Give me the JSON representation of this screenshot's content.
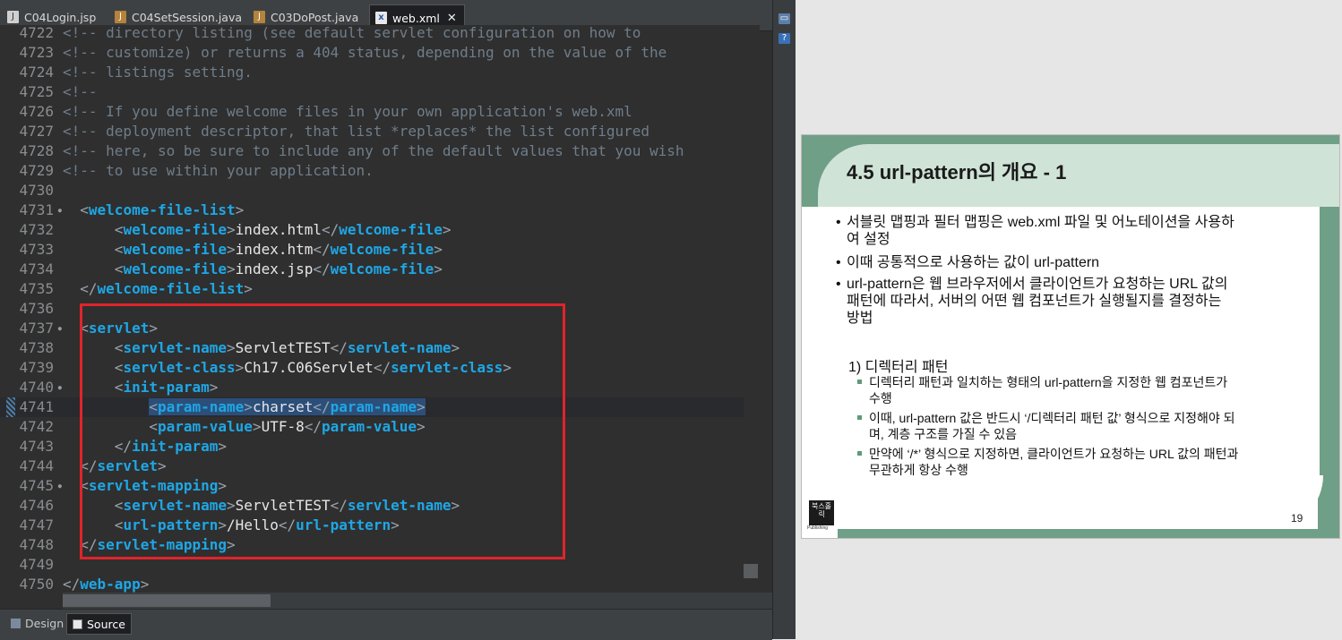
{
  "tabs": [
    {
      "label": "C04Login.jsp",
      "icon": "jsp-file-icon"
    },
    {
      "label": "C04SetSession.java",
      "icon": "java-file-icon"
    },
    {
      "label": "C03DoPost.java",
      "icon": "java-file-icon"
    },
    {
      "label": "web.xml",
      "icon": "xml-file-icon",
      "active": true
    }
  ],
  "code_lines": [
    {
      "n": "4722",
      "text": "<!-- directory listing (see default servlet configuration on how to"
    },
    {
      "n": "4723",
      "text": "<!-- customize) or returns a 404 status, depending on the value of the"
    },
    {
      "n": "4724",
      "text": "<!-- listings setting."
    },
    {
      "n": "4725",
      "text": "<!--"
    },
    {
      "n": "4726",
      "text": "<!-- If you define welcome files in your own application's web.xml"
    },
    {
      "n": "4727",
      "text": "<!-- deployment descriptor, that list *replaces* the list configured"
    },
    {
      "n": "4728",
      "text": "<!-- here, so be sure to include any of the default values that you wish"
    },
    {
      "n": "4729",
      "text": "<!-- to use within your application."
    },
    {
      "n": "4730",
      "text": ""
    },
    {
      "n": "4731",
      "text": "  <welcome-file-list>",
      "fold": true
    },
    {
      "n": "4732",
      "text": "      <welcome-file>index.html</welcome-file>"
    },
    {
      "n": "4733",
      "text": "      <welcome-file>index.htm</welcome-file>"
    },
    {
      "n": "4734",
      "text": "      <welcome-file>index.jsp</welcome-file>"
    },
    {
      "n": "4735",
      "text": "  </welcome-file-list>"
    },
    {
      "n": "4736",
      "text": ""
    },
    {
      "n": "4737",
      "text": "  <servlet>",
      "fold": true
    },
    {
      "n": "4738",
      "text": "      <servlet-name>ServletTEST</servlet-name>"
    },
    {
      "n": "4739",
      "text": "      <servlet-class>Ch17.C06Servlet</servlet-class>"
    },
    {
      "n": "4740",
      "text": "      <init-param>",
      "fold": true
    },
    {
      "n": "4741",
      "text": "          <param-name>charset</param-name>",
      "current": true,
      "selected": true
    },
    {
      "n": "4742",
      "text": "          <param-value>UTF-8</param-value>"
    },
    {
      "n": "4743",
      "text": "      </init-param>"
    },
    {
      "n": "4744",
      "text": "  </servlet>"
    },
    {
      "n": "4745",
      "text": "  <servlet-mapping>",
      "fold": true
    },
    {
      "n": "4746",
      "text": "      <servlet-name>ServletTEST</servlet-name>"
    },
    {
      "n": "4747",
      "text": "      <url-pattern>/Hello</url-pattern>"
    },
    {
      "n": "4748",
      "text": "  </servlet-mapping>"
    },
    {
      "n": "4749",
      "text": ""
    },
    {
      "n": "4750",
      "text": "</web-app>"
    }
  ],
  "bottom_tabs": {
    "design": "Design",
    "source": "Source"
  },
  "slide": {
    "title": "4.5 url-pattern의 개요 - 1",
    "bullets": [
      {
        "lines": [
          "서블릿 맵핑과 필터 맵핑은 web.xml 파일 및 어노테이션을 사용하",
          "여 설정"
        ]
      },
      {
        "lines": [
          "이때 공통적으로 사용하는 값이 url-pattern"
        ]
      },
      {
        "lines": [
          "url-pattern은 웹 브라우저에서 클라이언트가 요청하는 URL 값의",
          "패턴에 따라서, 서버의 어떤 웹 컴포넌트가 실행될지를 결정하는",
          "방법"
        ]
      }
    ],
    "section_heading": "1) 디렉터리 패턴",
    "sub_bullets": [
      {
        "lines": [
          "디렉터리 패턴과 일치하는 형태의 url-pattern을 지정한 웹 컴포넌트가",
          "수행"
        ]
      },
      {
        "lines": [
          "이때, url-pattern 값은 반드시 ‘/디렉터리 패턴 값’ 형식으로 지정해야 되",
          "며, 계층 구조를 가질 수 있음"
        ]
      },
      {
        "lines": [
          "만약에 ‘/*’ 형식으로 지정하면, 클라이언트가 요청하는 URL 값의 패턴과",
          "무관하게 항상 수행"
        ]
      }
    ],
    "page_number": "19",
    "logo_text": "북스홀릭",
    "logo_sub": "Publishing"
  },
  "colors": {
    "editor_bg": "#2f2f2f",
    "tag": "#1ea7e6",
    "comment": "#6f7d8a",
    "highlight_box": "#e0242b",
    "slide_green": "#6f9f86",
    "slide_header_light": "#cfe3d6"
  }
}
